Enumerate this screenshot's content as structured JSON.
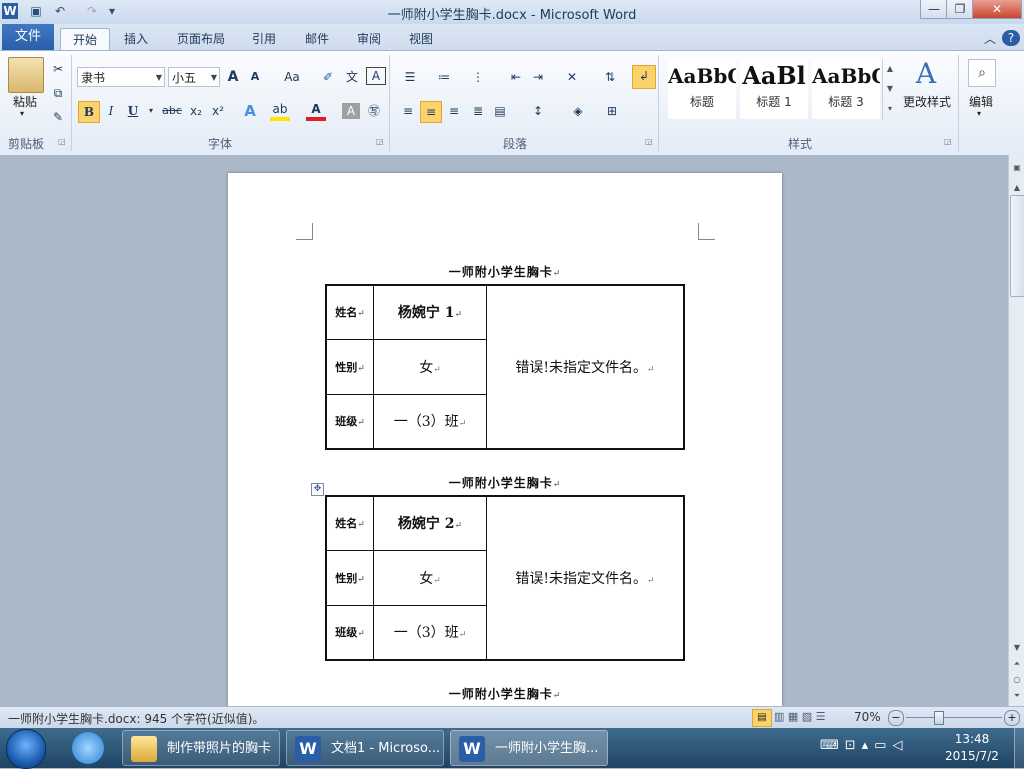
{
  "window": {
    "title": "一师附小学生胸卡.docx - Microsoft Word",
    "word_icon": "W"
  },
  "tabs": [
    "文件",
    "开始",
    "插入",
    "页面布局",
    "引用",
    "邮件",
    "审阅",
    "视图"
  ],
  "ribbon": {
    "clipboard": {
      "paste_label": "粘贴",
      "group_label": "剪贴板"
    },
    "font": {
      "name": "隶书",
      "size": "小五",
      "group_label": "字体",
      "buttons": {
        "bold": "B",
        "italic": "I",
        "underline": "U",
        "strike": "abc",
        "sub": "x₂",
        "sup": "x²",
        "grow": "A",
        "shrink": "A",
        "case": "Aa"
      }
    },
    "paragraph": {
      "group_label": "段落"
    },
    "styles": {
      "group_label": "样式",
      "items": [
        {
          "preview": "AaBbC",
          "name": "标题"
        },
        {
          "preview": "AaBl",
          "name": "标题 1"
        },
        {
          "preview": "AaBbC",
          "name": "标题 3"
        }
      ],
      "change_label": "更改样式"
    },
    "editing": {
      "label": "编辑"
    }
  },
  "document": {
    "cards": [
      {
        "title": "一师附小学生胸卡",
        "name_label": "姓名",
        "name": "杨婉宁 1",
        "gender_label": "性别",
        "gender": "女",
        "class_label": "班级",
        "class": "一（3）班",
        "photo_text": "错误!未指定文件名。"
      },
      {
        "title": "一师附小学生胸卡",
        "name_label": "姓名",
        "name": "杨婉宁 2",
        "gender_label": "性别",
        "gender": "女",
        "class_label": "班级",
        "class": "一（3）班",
        "photo_text": "错误!未指定文件名。"
      },
      {
        "title": "一师附小学生胸卡"
      }
    ]
  },
  "statusbar": {
    "info": "一师附小学生胸卡.docx: 945 个字符(近似值)。",
    "zoom": "70%",
    "zoom_minus": "−",
    "zoom_plus": "+"
  },
  "taskbar": {
    "items": [
      {
        "label": "制作带照片的胸卡",
        "icon": "folder-icon"
      },
      {
        "label": "文档1 - Microso...",
        "icon": "word-icon"
      },
      {
        "label": "一师附小学生胸...",
        "icon": "word-icon"
      }
    ],
    "clock_time": "13:48",
    "clock_date": "2015/7/2"
  },
  "colors": {
    "accent": "#2a5fa8",
    "taskbar": "#1f4463"
  }
}
